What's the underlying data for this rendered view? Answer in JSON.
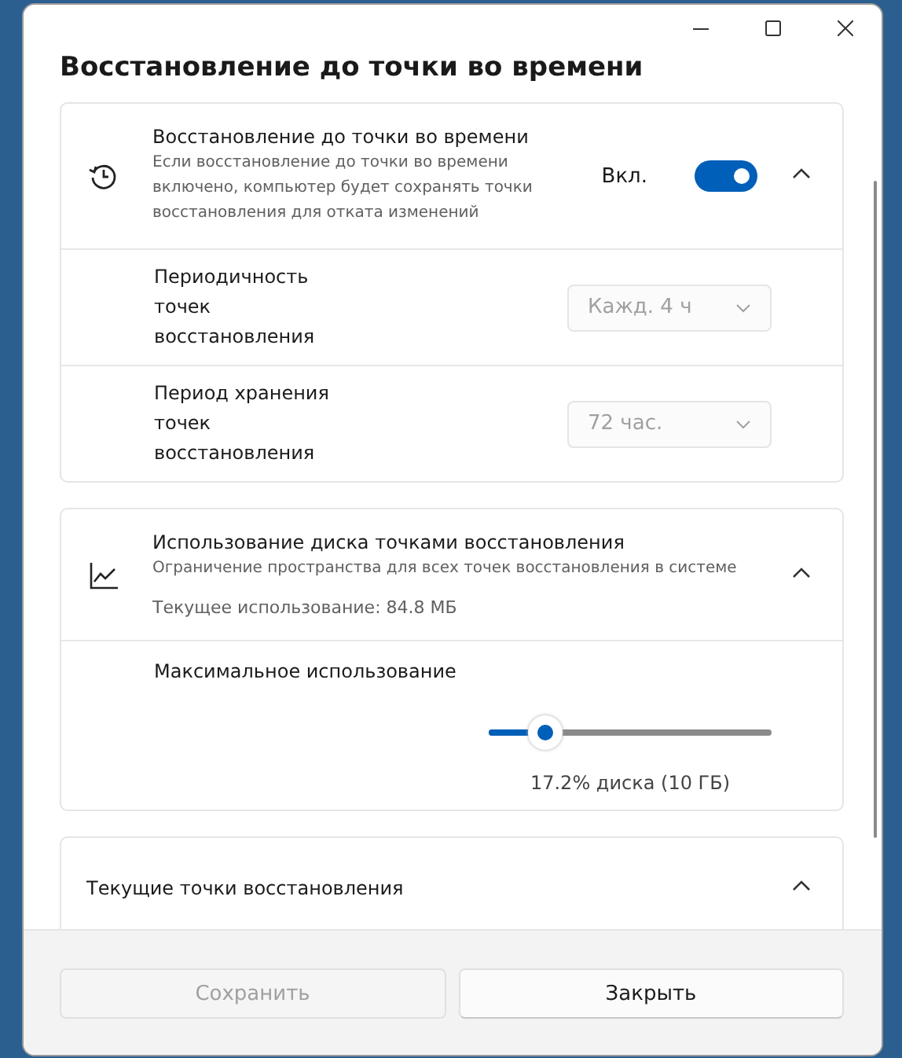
{
  "window": {
    "title": "Восстановление до точки во времени"
  },
  "sections": [
    {
      "kind": "toggle",
      "title": "Восстановление до точки во времени",
      "description": "Если восстановление до точки во времени включено, компьютер будет сохранять точки восстановления для отката изменений",
      "state_label": "Вкл.",
      "on": true,
      "expanded": true,
      "rows": [
        {
          "label": "Периодичность точек восстановления",
          "dropdown": {
            "value": "Кажд. 4 ч",
            "disabled": true
          }
        },
        {
          "label": "Период хранения точек восстановления",
          "dropdown": {
            "value": "72 час.",
            "disabled": true
          }
        }
      ]
    },
    {
      "kind": "usage",
      "title": "Использование диска точками восстановления",
      "description": "Ограничение пространства для всех точек восстановления в системе",
      "usage": "Текущее использование: 84.8 МБ",
      "expanded": true,
      "slider": {
        "label": "Максимальное использование",
        "level": 0.2,
        "reading": "17.2% диска (10 ГБ)"
      }
    },
    {
      "kind": "plain",
      "title": "Текущие точки восстановления",
      "expanded": true
    }
  ],
  "buttons": [
    {
      "label": "Сохранить",
      "disabled": true
    },
    {
      "label": "Закрыть",
      "disabled": false
    }
  ]
}
